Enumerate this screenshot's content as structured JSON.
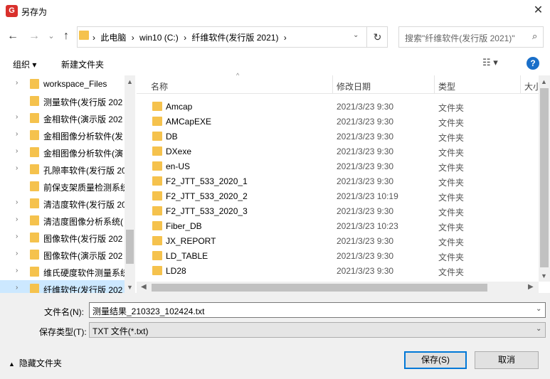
{
  "window": {
    "title": "另存为",
    "app_icon_letter": "G"
  },
  "nav": {
    "back_icon": "←",
    "forward_icon": "→",
    "recent_icon": "⌄",
    "up_icon": "↑",
    "breadcrumb": [
      "›",
      "此电脑",
      "›",
      "win10 (C:)",
      "›",
      "纤维软件(发行版 2021)",
      "›"
    ],
    "search_placeholder": "搜索\"纤维软件(发行版 2021)\""
  },
  "toolbar": {
    "organize": "组织 ▾",
    "new_folder": "新建文件夹",
    "view_icon": "☷ ▾",
    "help": "?"
  },
  "tree": [
    {
      "label": "workspace_Files",
      "arrow": "›"
    },
    {
      "label": "测量软件(发行版 202",
      "arrow": ""
    },
    {
      "label": "金相软件(演示版 202",
      "arrow": "›"
    },
    {
      "label": "金相图像分析软件(发",
      "arrow": "›"
    },
    {
      "label": "金相图像分析软件(演",
      "arrow": "›"
    },
    {
      "label": "孔隙率软件(发行版 20",
      "arrow": "›"
    },
    {
      "label": "前保支架质量检测系统",
      "arrow": ""
    },
    {
      "label": "清洁度软件(发行版 20",
      "arrow": "›"
    },
    {
      "label": "清洁度图像分析系统(",
      "arrow": "›"
    },
    {
      "label": "图像软件(发行版 202",
      "arrow": "›"
    },
    {
      "label": "图像软件(演示版 202",
      "arrow": "›"
    },
    {
      "label": "维氏硬度软件测量系统",
      "arrow": "›"
    },
    {
      "label": "纤维软件(发行版 202",
      "arrow": "›"
    }
  ],
  "columns": {
    "name": "名称",
    "date": "修改日期",
    "type": "类型",
    "size": "大小"
  },
  "files": [
    {
      "name": "Amcap",
      "date": "2021/3/23 9:30",
      "type": "文件夹"
    },
    {
      "name": "AMCapEXE",
      "date": "2021/3/23 9:30",
      "type": "文件夹"
    },
    {
      "name": "DB",
      "date": "2021/3/23 9:30",
      "type": "文件夹"
    },
    {
      "name": "DXexe",
      "date": "2021/3/23 9:30",
      "type": "文件夹"
    },
    {
      "name": "en-US",
      "date": "2021/3/23 9:30",
      "type": "文件夹"
    },
    {
      "name": "F2_JTT_533_2020_1",
      "date": "2021/3/23 9:30",
      "type": "文件夹"
    },
    {
      "name": "F2_JTT_533_2020_2",
      "date": "2021/3/23 10:19",
      "type": "文件夹"
    },
    {
      "name": "F2_JTT_533_2020_3",
      "date": "2021/3/23 9:30",
      "type": "文件夹"
    },
    {
      "name": "Fiber_DB",
      "date": "2021/3/23 10:23",
      "type": "文件夹"
    },
    {
      "name": "JX_REPORT",
      "date": "2021/3/23 9:30",
      "type": "文件夹"
    },
    {
      "name": "LD_TABLE",
      "date": "2021/3/23 9:30",
      "type": "文件夹"
    },
    {
      "name": "LD28",
      "date": "2021/3/23 9:30",
      "type": "文件夹"
    }
  ],
  "form": {
    "filename_label": "文件名(N):",
    "filename_value": "测量结果_210323_102424.txt",
    "type_label": "保存类型(T):",
    "type_value": "TXT 文件(*.txt)"
  },
  "footer": {
    "hide_folders": "隐藏文件夹",
    "hide_icon": "▲",
    "save": "保存(S)",
    "cancel": "取消"
  },
  "colors": {
    "accent": "#0078d7",
    "selected": "#cce8ff",
    "folder": "#f5c24d"
  }
}
